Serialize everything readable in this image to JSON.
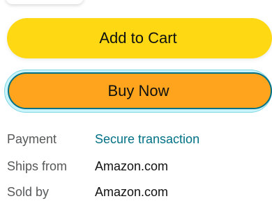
{
  "buttons": {
    "add_to_cart": "Add to Cart",
    "buy_now": "Buy Now"
  },
  "details": [
    {
      "label": "Payment",
      "value": "Secure transaction"
    },
    {
      "label": "Ships from",
      "value": "Amazon.com"
    },
    {
      "label": "Sold by",
      "value": "Amazon.com"
    }
  ],
  "colors": {
    "add_to_cart_bg": "#ffd814",
    "buy_now_bg": "#ffa41c",
    "link": "#007185",
    "label_text": "#565959"
  }
}
